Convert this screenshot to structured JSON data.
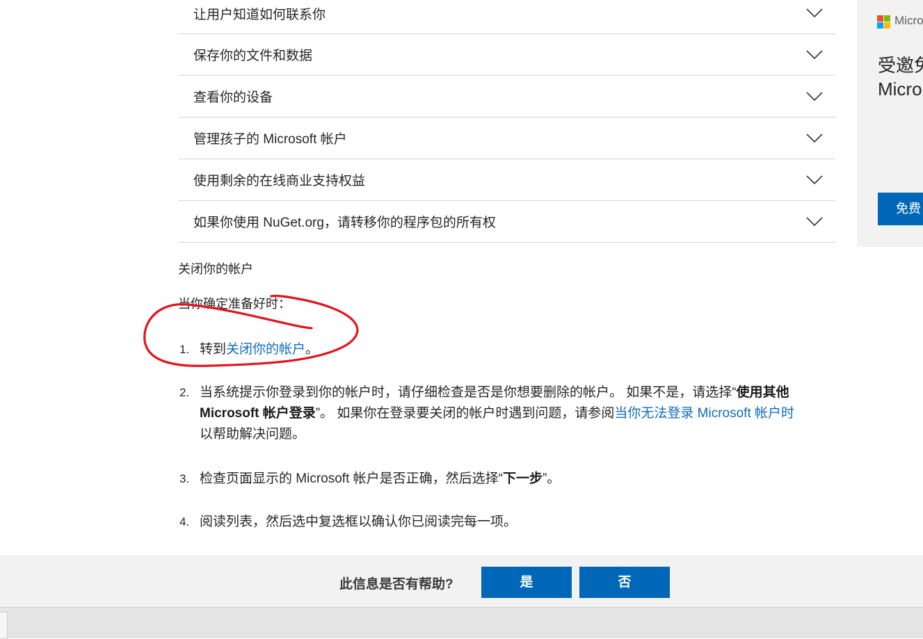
{
  "accordion": {
    "items": [
      {
        "label": "让用户知道如何联系你"
      },
      {
        "label": "保存你的文件和数据"
      },
      {
        "label": "查看你的设备"
      },
      {
        "label": "管理孩子的 Microsoft 帐户"
      },
      {
        "label": "使用剩余的在线商业支持权益"
      },
      {
        "label": "如果你使用 NuGet.org，请转移你的程序包的所有权"
      }
    ]
  },
  "content": {
    "section_title": "关闭你的帐户",
    "intro": "当你确定准备好时：",
    "steps": [
      {
        "num": "1.",
        "pre": "转到",
        "link": "关闭你的帐户",
        "post": "。"
      },
      {
        "num": "2.",
        "line1_a": "当系统提示你登录到你的帐户时，请仔细检查是否是你想要删除的帐户。 如果不是，请选择“",
        "line1_bold": "使用其他",
        "line2_bold": "Microsoft 帐户登录",
        "line2_a": "”。 如果你在登录要关闭的帐户时遇到问题，请参阅",
        "line2_link": "当你无法登录 Microsoft 帐户时",
        "line3": "以帮助解决问题。"
      },
      {
        "num": "3.",
        "pre": "检查页面显示的 Microsoft 帐户是否正确，然后选择“",
        "bold": "下一步",
        "post": "”。"
      },
      {
        "num": "4.",
        "text": "阅读列表，然后选中复选框以确认你已阅读完每一项。"
      }
    ]
  },
  "side": {
    "brand": "Micro",
    "headline_1": "受邀免",
    "headline_2": "Micro",
    "button": "免费"
  },
  "feedback": {
    "question": "此信息是否有帮助?",
    "yes": "是",
    "no": "否"
  },
  "colors": {
    "link": "#0f6cbd",
    "button": "#0067b8",
    "annotation": "#e0141e"
  }
}
